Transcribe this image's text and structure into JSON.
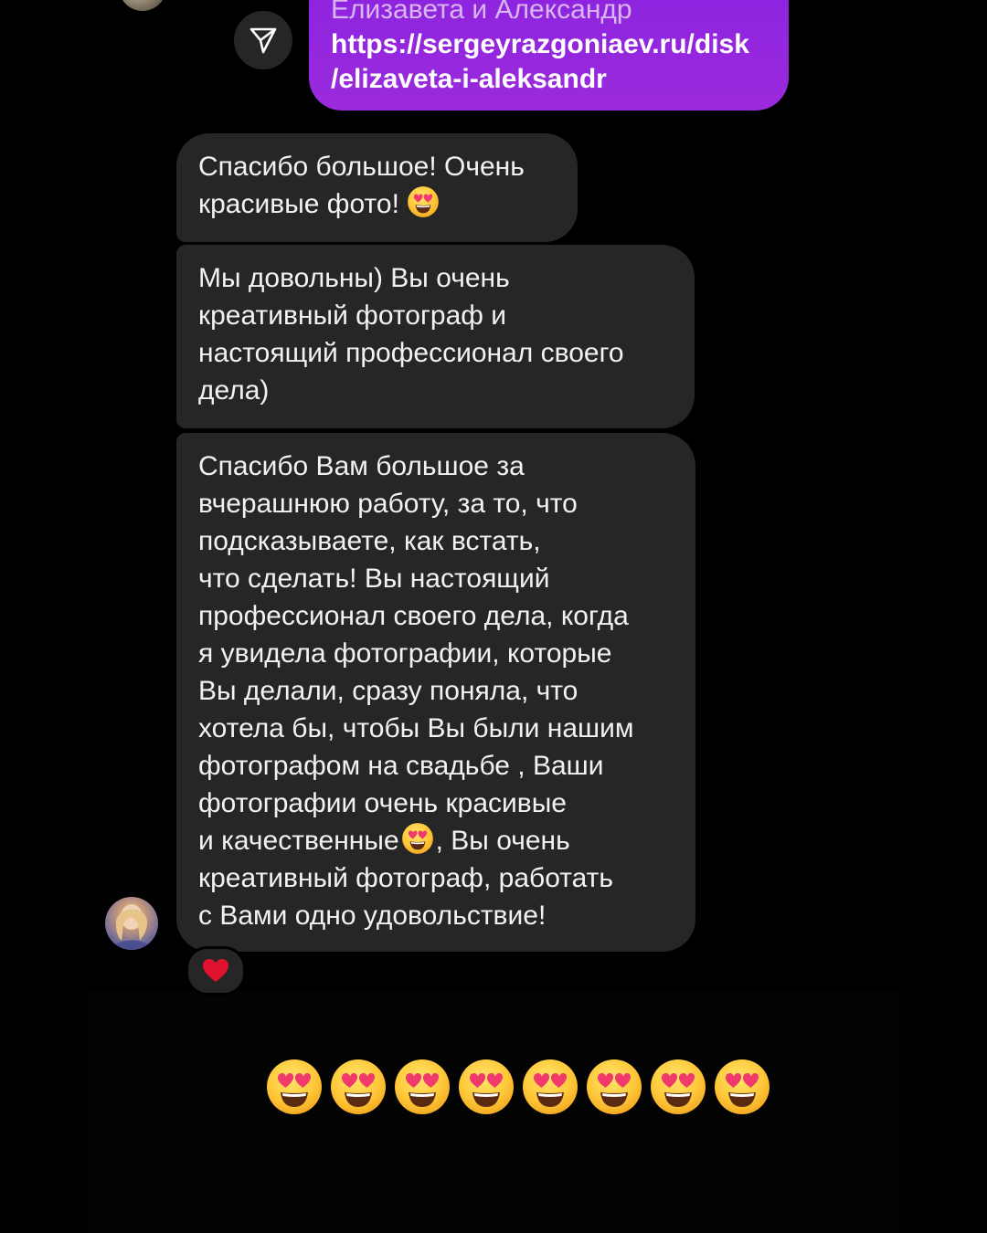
{
  "chat": {
    "outgoing_message": {
      "lines": [
        "Елизавета и Александр",
        "https://sergeyrazgoniaev.ru/disk",
        "/elizaveta-i-aleksandr"
      ]
    },
    "incoming_messages": [
      {
        "lines": [
          "Спасибо большое! Очень",
          "красивые фото!"
        ],
        "trailing_emoji": "heart-eyes-emoji"
      },
      {
        "lines": [
          "Мы довольны) Вы очень",
          "креативный фотограф и",
          "настоящий профессионал своего",
          "дела)"
        ]
      },
      {
        "lines": [
          "Спасибо Вам большое за",
          "вчерашнюю работу, за то, что",
          "подсказываете, как встать,",
          "что сделать! Вы настоящий",
          "профессионал своего дела, когда",
          "я увидела фотографии, которые",
          "Вы делали, сразу поняла, что",
          "хотела бы, чтобы Вы были нашим",
          "фотографом на свадьбе , Ваши",
          "фотографии очень красивые",
          "и качественные",
          "Вы очень",
          "креативный фотограф, работать",
          "с Вами одно удовольствие!"
        ],
        "reaction": "red-heart-icon"
      }
    ],
    "emoji_row_count": 8,
    "icons": {
      "share": "send-icon",
      "reaction": "red-heart-icon",
      "emoji": "heart-eyes-emoji"
    },
    "colors": {
      "background": "#000000",
      "incoming_bubble": "#262626",
      "outgoing_bubble": "#8a22e0",
      "heart": "#e0122d"
    }
  }
}
